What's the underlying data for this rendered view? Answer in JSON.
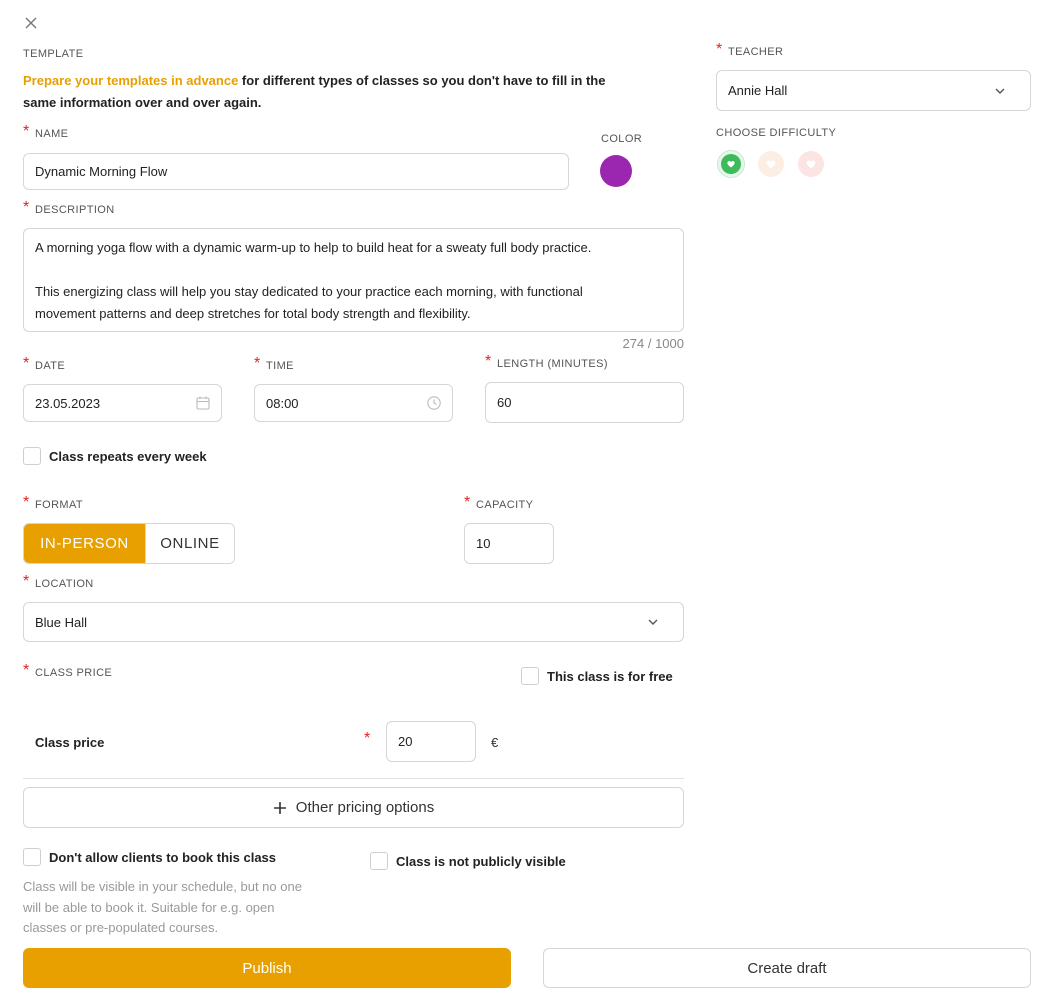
{
  "close_icon_label": "✕",
  "template": {
    "label": "TEMPLATE",
    "highlight": "Prepare your templates in advance",
    "text_line1": " for different types of classes so you don't have to fill in the",
    "text_line2": "same information over and over again."
  },
  "name": {
    "label": "NAME",
    "value": "Dynamic Morning Flow"
  },
  "color": {
    "label": "COLOR",
    "value": "#9b27b0"
  },
  "description": {
    "label": "DESCRIPTION",
    "paragraph1": "A morning yoga flow with a dynamic warm-up to help to build heat for a sweaty full body practice.",
    "paragraph2_line1": "This energizing class will help you stay dedicated to your practice each morning, with functional",
    "paragraph2_line2": "movement patterns and deep stretches for total body strength and flexibility.",
    "counter": "274 / 1000"
  },
  "date": {
    "label": "DATE",
    "value": "23.05.2023"
  },
  "time": {
    "label": "TIME",
    "value": "08:00"
  },
  "length": {
    "label": "LENGTH (MINUTES)",
    "value": "60"
  },
  "repeats": {
    "label": "Class repeats every week",
    "checked": false
  },
  "format": {
    "label": "FORMAT",
    "options": [
      "IN-PERSON",
      "ONLINE"
    ],
    "selected": "IN-PERSON"
  },
  "capacity": {
    "label": "CAPACITY",
    "value": "10"
  },
  "location": {
    "label": "LOCATION",
    "value": "Blue Hall"
  },
  "price": {
    "label": "CLASS PRICE",
    "free_label": "This class is for free",
    "row_label": "Class price",
    "value": "20",
    "currency": "€",
    "other_options": "Other pricing options"
  },
  "booking": {
    "no_book_label": "Don't allow clients to book this class",
    "no_book_help_line1": "Class will be visible in your schedule, but no one",
    "no_book_help_line2": "will be able to book it. Suitable for e.g. open",
    "no_book_help_line3": "classes or pre-populated courses.",
    "not_public_label": "Class is not publicly visible"
  },
  "teacher": {
    "label": "TEACHER",
    "value": "Annie Hall"
  },
  "difficulty": {
    "label": "CHOOSE DIFFICULTY",
    "levels": [
      "easy",
      "medium",
      "hard"
    ],
    "selected": "easy"
  },
  "actions": {
    "publish": "Publish",
    "draft": "Create draft"
  },
  "colors": {
    "accent": "#e8a000",
    "accent_text": "#e8a000",
    "required": "#e02424"
  }
}
